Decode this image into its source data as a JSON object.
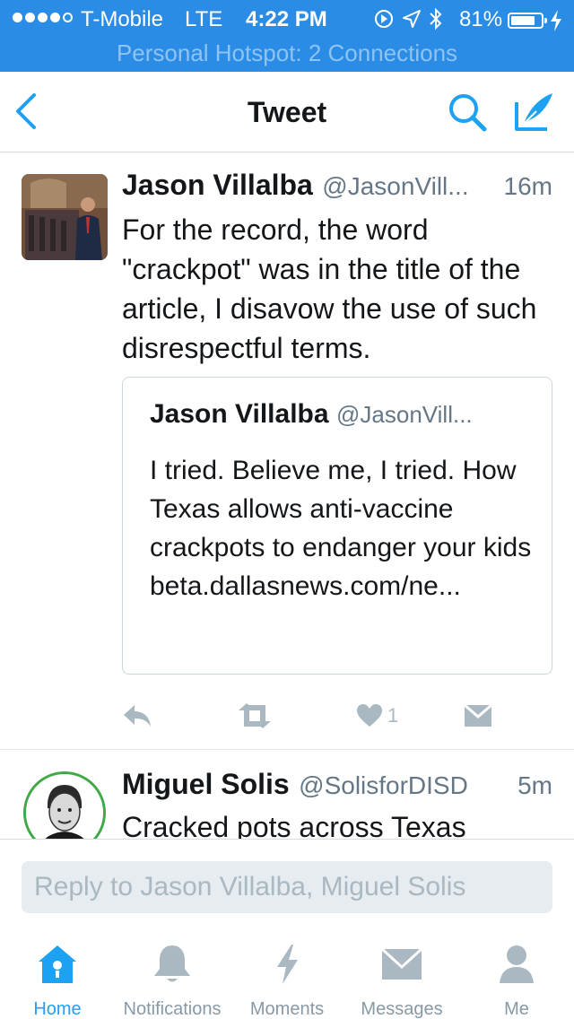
{
  "status_bar": {
    "carrier": "T-Mobile",
    "network": "LTE",
    "time": "4:22 PM",
    "battery_percent": "81%",
    "battery_level": 0.81,
    "hotspot": "Personal Hotspot: 2 Connections"
  },
  "nav": {
    "title": "Tweet"
  },
  "tweet": {
    "author_name": "Jason Villalba",
    "handle": "@JasonVill...",
    "time": "16m",
    "text": "For the record, the word \"crackpot\" was in the title of the article, I disavow the use of such disrespectful terms.",
    "quote": {
      "author_name": "Jason Villalba",
      "handle": "@JasonVill...",
      "text": "I tried. Believe me, I tried. How Texas allows anti-vaccine crackpots to endanger your kids beta.dallasnews.com/ne..."
    },
    "like_count": "1"
  },
  "second_tweet": {
    "author_name": "Miguel Solis",
    "handle": "@SolisforDISD",
    "time": "5m",
    "text": "Cracked pots across Texas"
  },
  "reply": {
    "placeholder": "Reply to Jason Villalba, Miguel Solis"
  },
  "tabbar": {
    "home": "Home",
    "notifications": "Notifications",
    "moments": "Moments",
    "messages": "Messages",
    "me": "Me"
  },
  "colors": {
    "status_bar": "#2b8ce6",
    "accent": "#1da1f2",
    "muted": "#657786",
    "inactive_icon": "#aab8c2",
    "avatar_ring": "#3fa847"
  }
}
